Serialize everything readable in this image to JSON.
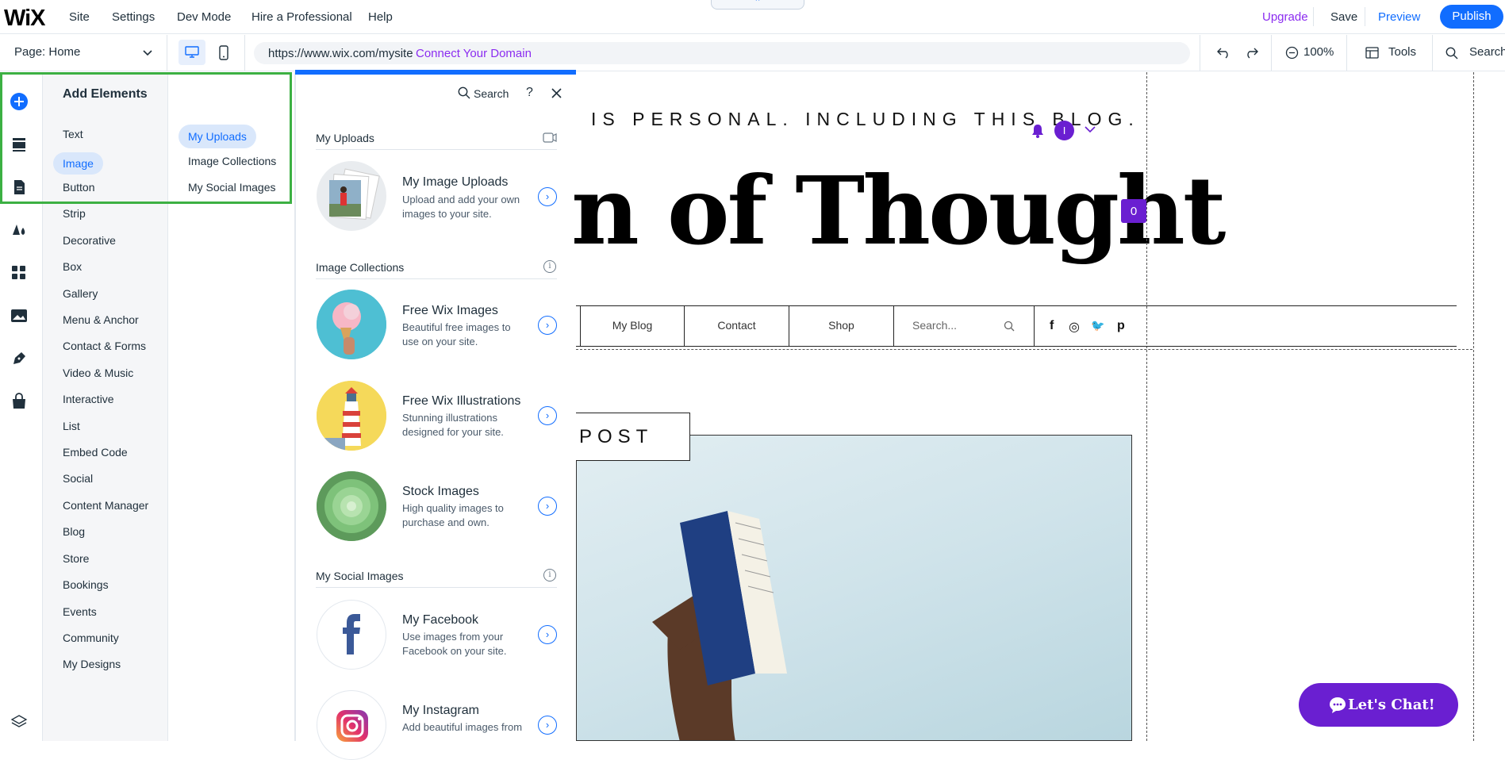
{
  "topbar": {
    "logo": "WiX",
    "menu": [
      "Site",
      "Settings",
      "Dev Mode",
      "Hire a Professional",
      "Help"
    ],
    "upgrade": "Upgrade",
    "save": "Save",
    "preview": "Preview",
    "publish": "Publish",
    "collapse_glyph": "⌃"
  },
  "toolbar": {
    "page_label": "Page:",
    "page_value": "Home",
    "url": "https://www.wix.com/mysite",
    "connect_domain": "Connect Your Domain",
    "zoom": "100%",
    "tools": "Tools",
    "search": "Search"
  },
  "panel": {
    "title": "Add Elements",
    "search": "Search",
    "help": "?",
    "categories": [
      "Text",
      "Image",
      "Button",
      "Strip",
      "Decorative",
      "Box",
      "Gallery",
      "Menu & Anchor",
      "Contact & Forms",
      "Video & Music",
      "Interactive",
      "List",
      "Embed Code",
      "Social",
      "Content Manager",
      "Blog",
      "Store",
      "Bookings",
      "Events",
      "Community",
      "My Designs"
    ],
    "selected_category": "Image",
    "subcategories": [
      "My Uploads",
      "Image Collections",
      "My Social Images"
    ],
    "selected_subcategory": "My Uploads",
    "sections": {
      "uploads": {
        "title": "My Uploads",
        "items": [
          {
            "title": "My Image Uploads",
            "desc1": "Upload and add your own",
            "desc2": "images to your site."
          }
        ]
      },
      "collections": {
        "title": "Image Collections",
        "items": [
          {
            "title": "Free Wix Images",
            "desc1": "Beautiful free images to",
            "desc2": "use on your site."
          },
          {
            "title": "Free Wix Illustrations",
            "desc1": "Stunning illustrations",
            "desc2": "designed for your site."
          },
          {
            "title": "Stock Images",
            "desc1": "High quality images to",
            "desc2": "purchase and own."
          }
        ]
      },
      "social": {
        "title": "My Social Images",
        "items": [
          {
            "title": "My Facebook",
            "desc1": "Use images from your",
            "desc2": "Facebook on your site."
          },
          {
            "title": "My Instagram",
            "desc1": "Add beautiful images from",
            "desc2": ""
          }
        ]
      }
    }
  },
  "site": {
    "tagline": "IS PERSONAL. INCLUDING THIS BLOG.",
    "title": "n of Thought",
    "avatar_initial": "I",
    "cart_count": "0",
    "nav": [
      "My Blog",
      "Contact",
      "Shop"
    ],
    "search_placeholder": "Search...",
    "social": [
      "f",
      "◎",
      "🐦",
      "p"
    ],
    "post_label": "POST",
    "chat": "Let's Chat!"
  },
  "colors": {
    "accent": "#116dff",
    "upgrade": "#8b2cf0",
    "site_purple": "#6a1fd1",
    "highlight_box": "#3cb043"
  }
}
